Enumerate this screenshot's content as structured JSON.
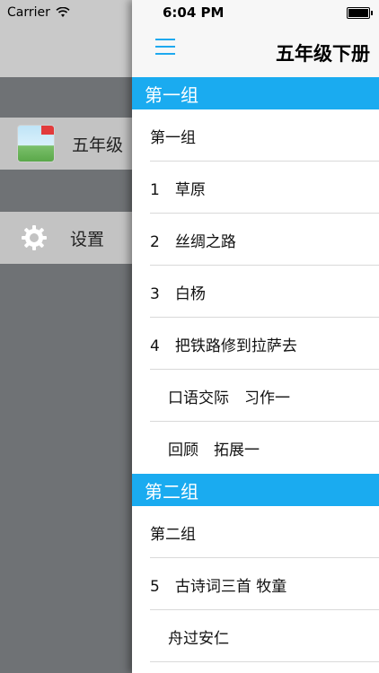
{
  "status_bar": {
    "carrier": "Carrier",
    "time": "6:04 PM"
  },
  "drawer": {
    "book_label": "五年级",
    "settings_label": "设置"
  },
  "header": {
    "title": "五年级下册"
  },
  "sections": [
    {
      "title": "第一组",
      "items": [
        {
          "text": "第一组",
          "indent": false
        },
        {
          "text": "1　草原",
          "indent": false
        },
        {
          "text": "2　丝绸之路",
          "indent": false
        },
        {
          "text": "3　白杨",
          "indent": false
        },
        {
          "text": "4　把铁路修到拉萨去",
          "indent": false
        },
        {
          "text": "口语交际　习作一",
          "indent": true
        },
        {
          "text": "回顾　拓展一",
          "indent": true
        }
      ]
    },
    {
      "title": "第二组",
      "items": [
        {
          "text": "第二组",
          "indent": false
        },
        {
          "text": "5　古诗词三首 牧童",
          "indent": false
        },
        {
          "text": "舟过安仁",
          "indent": true
        }
      ]
    }
  ],
  "colors": {
    "accent": "#1aabf0",
    "drawer_bg": "#6f7275"
  }
}
